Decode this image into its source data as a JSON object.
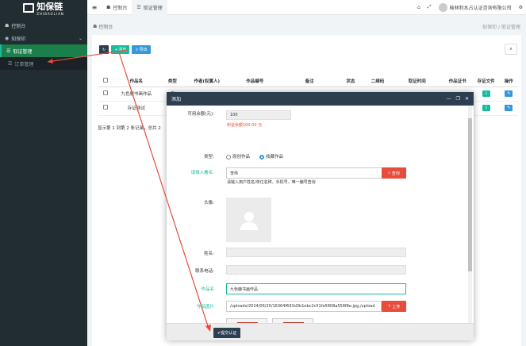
{
  "app": {
    "logo": "知保链",
    "logo_sub": "ZHIBAOLIAN"
  },
  "sidebar": {
    "items": [
      {
        "label": "控制台",
        "icon": "dashboard-icon"
      },
      {
        "label": "知保印",
        "icon": "stamp-icon"
      },
      {
        "label": "取证管理",
        "icon": "list-icon"
      },
      {
        "label": "订单管理",
        "icon": "order-icon"
      }
    ]
  },
  "topbar": {
    "tabs": [
      {
        "label": "控制台"
      },
      {
        "label": "取证管理"
      }
    ],
    "user": "榆林利水占认证咨询有限公司"
  },
  "breadcrumb": {
    "left": "控制台",
    "right": "知保印 / 取证管理"
  },
  "toolbar": {
    "add": "添加",
    "export": "导出"
  },
  "table": {
    "headers": [
      "作品名",
      "类型",
      "作者(权属人)",
      "作品编号",
      "备注",
      "状态",
      "二维码",
      "取证时间",
      "作品证书",
      "存证文件",
      "操作"
    ],
    "rows": [
      {
        "name": "九色鹿书画作品"
      },
      {
        "name": "存证测试"
      }
    ],
    "pager": "显示第 1 到第 2 条记录，总共 2"
  },
  "modal": {
    "title": "添加",
    "balance_label": "可用余额(元):",
    "balance_value": "100",
    "freeze_hint": "积证余额100.00 元",
    "type_label": "类型:",
    "type_options": [
      "原创作品",
      "收藏作品"
    ],
    "owner_label": "请填入署名:",
    "owner_value": "李伟",
    "query_btn": "查询",
    "owner_hint": "请输入用户姓名/单位名称、手机号、唯一编号查询",
    "avatar_label": "头像:",
    "name_label": "姓名:",
    "phone_label": "联系电话:",
    "work_label": "作品名",
    "work_value": "九色鹿书画作品",
    "image_label": "作品图片",
    "image_value": "/uploads/2024/06/20/16364f693d3b1ebc2c51fe5808a558f8e.jpg,/upload",
    "upload_btn": "上传",
    "submit_btn": "提交认证"
  }
}
